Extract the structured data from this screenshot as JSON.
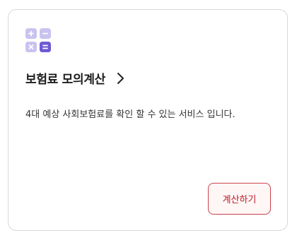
{
  "card": {
    "icon": "calculator-icon",
    "title": "보험료 모의계산",
    "title_chevron_icon": "chevron-right-icon",
    "description": "4대 예상 사회보험료를 확인 할 수 있는 서비스 입니다.",
    "button_label": "계산하기"
  },
  "colors": {
    "icon_light": "#c8c3ef",
    "icon_accent": "#6e5ad3",
    "button_border": "#c9434a",
    "button_text": "#b71f28",
    "button_bg": "#fff6f6"
  }
}
